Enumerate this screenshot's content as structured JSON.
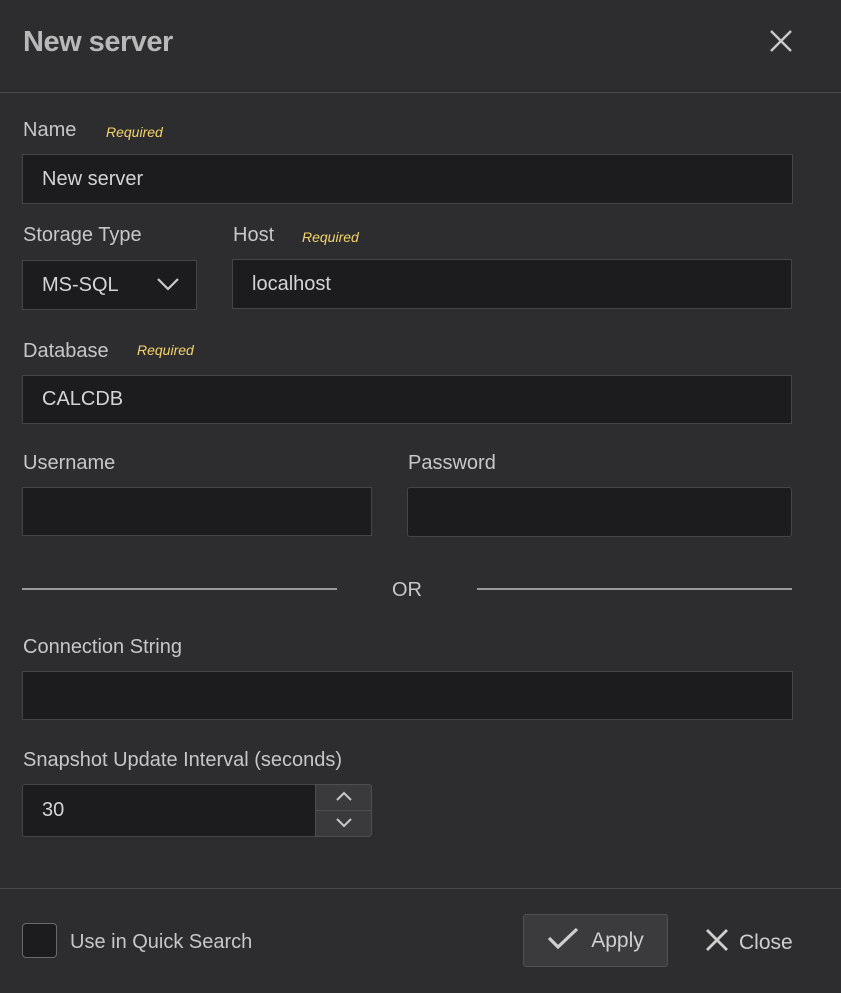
{
  "dialog": {
    "title": "New server"
  },
  "fields": {
    "name": {
      "label": "Name",
      "required": "Required",
      "value": "New server"
    },
    "storage_type": {
      "label": "Storage Type",
      "value": "MS-SQL"
    },
    "host": {
      "label": "Host",
      "required": "Required",
      "value": "localhost"
    },
    "database": {
      "label": "Database",
      "required": "Required",
      "value": "CALCDB"
    },
    "username": {
      "label": "Username",
      "value": ""
    },
    "password": {
      "label": "Password",
      "value": ""
    },
    "or_divider": "OR",
    "connection_string": {
      "label": "Connection String",
      "value": ""
    },
    "snapshot_interval": {
      "label": "Snapshot Update Interval (seconds)",
      "value": "30"
    }
  },
  "footer": {
    "quick_search_label": "Use in Quick Search",
    "quick_search_checked": false,
    "apply_label": "Apply",
    "close_label": "Close"
  },
  "icons": {
    "close": "close-icon",
    "dropdown": "chevron-down-icon",
    "stepper_up": "chevron-up-icon",
    "stepper_down": "chevron-down-icon",
    "apply": "check-icon"
  },
  "colors": {
    "background": "#2d2d2f",
    "input_background": "#1c1c1e",
    "required": "#f3d36a"
  }
}
